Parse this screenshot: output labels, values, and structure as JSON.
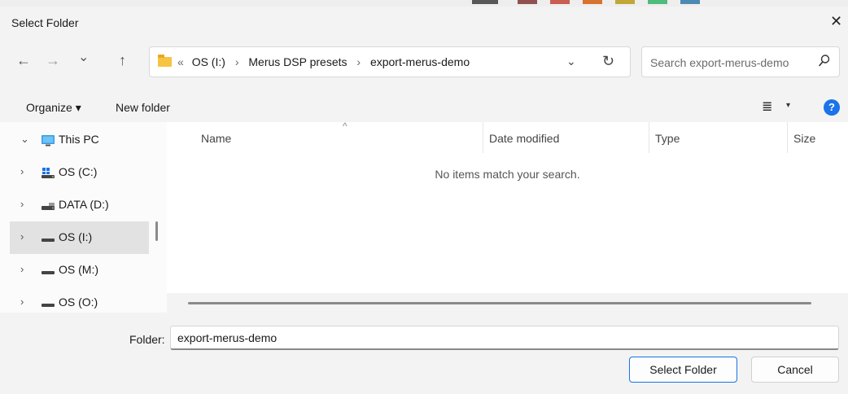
{
  "window": {
    "title": "Select Folder",
    "close_glyph": "✕"
  },
  "nav": {
    "back_glyph": "←",
    "forward_glyph": "→",
    "recent_glyph": "⌄",
    "up_glyph": "↑"
  },
  "address": {
    "overflow_glyph": "«",
    "crumbs": [
      "OS (I:)",
      "Merus DSP presets",
      "export-merus-demo"
    ],
    "separator": "›",
    "dropdown_glyph": "⌄",
    "refresh_glyph": "↻"
  },
  "search": {
    "placeholder": "Search export-merus-demo",
    "value": ""
  },
  "toolbar": {
    "organize_label": "Organize ▾",
    "new_folder_label": "New folder",
    "view_glyph": "≣",
    "view_dropdown_glyph": "▾",
    "help_glyph": "?"
  },
  "sidebar": {
    "items": [
      {
        "chevron": "⌄",
        "label": "This PC",
        "icon": "monitor-icon",
        "selected": false
      },
      {
        "chevron": "›",
        "label": "OS (C:)",
        "icon": "windows-drive-icon",
        "selected": false
      },
      {
        "chevron": "›",
        "label": "DATA (D:)",
        "icon": "drive-icon",
        "selected": false
      },
      {
        "chevron": "›",
        "label": "OS (I:)",
        "icon": "drive-icon",
        "selected": true
      },
      {
        "chevron": "›",
        "label": "OS (M:)",
        "icon": "drive-icon",
        "selected": false
      },
      {
        "chevron": "›",
        "label": "OS (O:)",
        "icon": "drive-icon",
        "selected": false
      }
    ]
  },
  "list": {
    "columns": [
      "Name",
      "Date modified",
      "Type",
      "Size"
    ],
    "sort_glyph": "^",
    "empty_message": "No items match your search."
  },
  "footer": {
    "folder_label": "Folder:",
    "folder_value": "export-merus-demo",
    "select_button": "Select Folder",
    "cancel_button": "Cancel"
  },
  "colors": {
    "accent": "#1a73e8",
    "selection": "#e2e2e2",
    "folder": "#f6c343"
  }
}
